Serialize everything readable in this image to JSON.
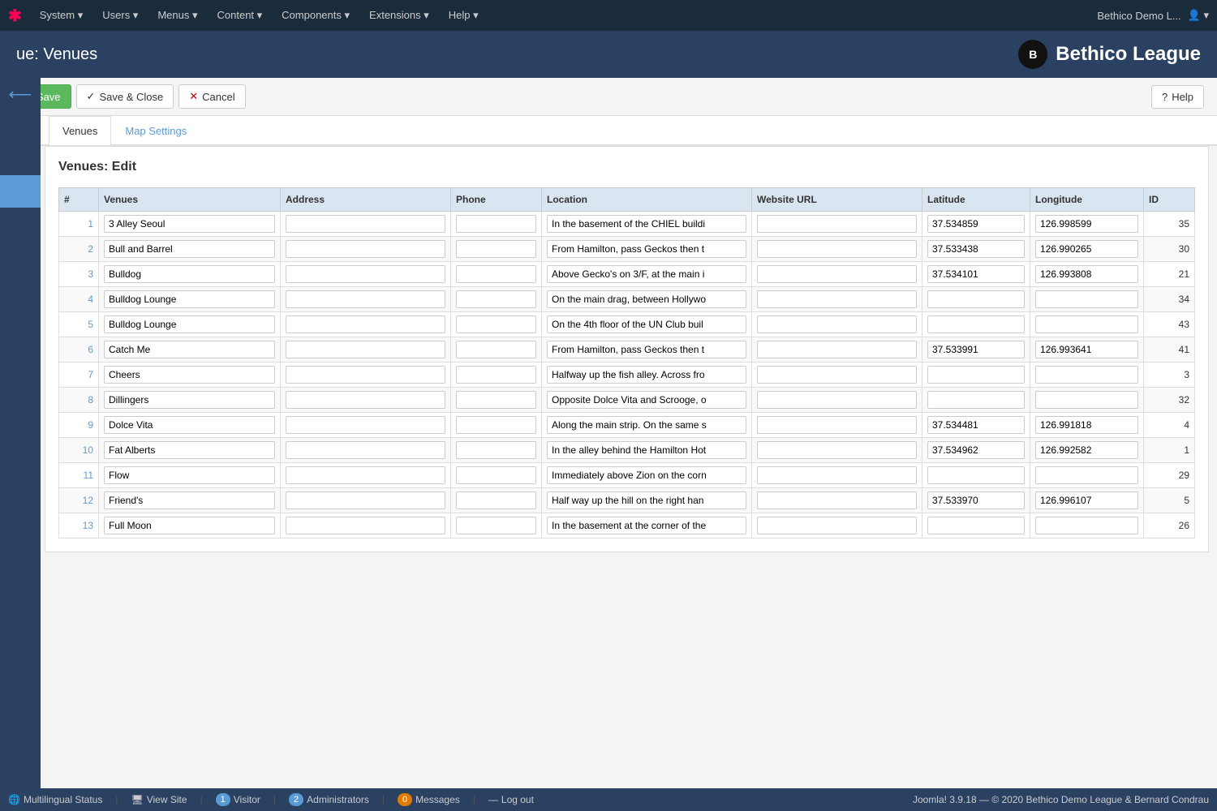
{
  "navbar": {
    "logo": "X",
    "items": [
      {
        "label": "System",
        "id": "system"
      },
      {
        "label": "Users",
        "id": "users"
      },
      {
        "label": "Menus",
        "id": "menus"
      },
      {
        "label": "Content",
        "id": "content"
      },
      {
        "label": "Components",
        "id": "components"
      },
      {
        "label": "Extensions",
        "id": "extensions"
      },
      {
        "label": "Help",
        "id": "help"
      }
    ],
    "user_text": "Bethico Demo L...",
    "user_icon": "👤"
  },
  "page_title": "ue: Venues",
  "brand": {
    "name": "Bethico League",
    "icon_text": "B"
  },
  "toolbar": {
    "save_label": "Save",
    "save_close_label": "Save & Close",
    "cancel_label": "Cancel",
    "help_label": "Help"
  },
  "tabs": [
    {
      "label": "Venues",
      "active": true
    },
    {
      "label": "Map Settings",
      "active": false
    }
  ],
  "section_title": "Venues: Edit",
  "table": {
    "columns": [
      "#",
      "Venues",
      "Address",
      "Phone",
      "Location",
      "Website URL",
      "Latitude",
      "Longitude",
      "ID"
    ],
    "rows": [
      {
        "num": 1,
        "venue": "3 Alley Seoul",
        "address": "",
        "phone": "",
        "location": "In the basement of the CHIEL buildi",
        "website": "",
        "latitude": "37.534859",
        "longitude": "126.998599",
        "id": 35
      },
      {
        "num": 2,
        "venue": "Bull and Barrel",
        "address": "",
        "phone": "",
        "location": "From Hamilton, pass Geckos then t",
        "website": "",
        "latitude": "37.533438",
        "longitude": "126.990265",
        "id": 30
      },
      {
        "num": 3,
        "venue": "Bulldog",
        "address": "",
        "phone": "",
        "location": "Above Gecko's on 3/F, at the main i",
        "website": "",
        "latitude": "37.534101",
        "longitude": "126.993808",
        "id": 21
      },
      {
        "num": 4,
        "venue": "Bulldog Lounge",
        "address": "",
        "phone": "",
        "location": "On the main drag, between Hollywo",
        "website": "",
        "latitude": "",
        "longitude": "",
        "id": 34
      },
      {
        "num": 5,
        "venue": "Bulldog Lounge",
        "address": "",
        "phone": "",
        "location": "On the 4th floor of the UN Club buil",
        "website": "",
        "latitude": "",
        "longitude": "",
        "id": 43
      },
      {
        "num": 6,
        "venue": "Catch Me",
        "address": "",
        "phone": "",
        "location": "From Hamilton, pass Geckos then t",
        "website": "",
        "latitude": "37.533991",
        "longitude": "126.993641",
        "id": 41
      },
      {
        "num": 7,
        "venue": "Cheers",
        "address": "",
        "phone": "",
        "location": "Halfway up the fish alley. Across fro",
        "website": "",
        "latitude": "",
        "longitude": "",
        "id": 3
      },
      {
        "num": 8,
        "venue": "Dillingers",
        "address": "",
        "phone": "",
        "location": "Opposite Dolce Vita and Scrooge, o",
        "website": "",
        "latitude": "",
        "longitude": "",
        "id": 32
      },
      {
        "num": 9,
        "venue": "Dolce Vita",
        "address": "",
        "phone": "",
        "location": "Along the main strip. On the same s",
        "website": "",
        "latitude": "37.534481",
        "longitude": "126.991818",
        "id": 4
      },
      {
        "num": 10,
        "venue": "Fat Alberts",
        "address": "",
        "phone": "",
        "location": "In the alley behind the Hamilton Hot",
        "website": "",
        "latitude": "37.534962",
        "longitude": "126.992582",
        "id": 1
      },
      {
        "num": 11,
        "venue": "Flow",
        "address": "",
        "phone": "",
        "location": "Immediately above Zion on the corn",
        "website": "",
        "latitude": "",
        "longitude": "",
        "id": 29
      },
      {
        "num": 12,
        "venue": "Friend's",
        "address": "",
        "phone": "",
        "location": "Half way up the hill on the right han",
        "website": "",
        "latitude": "37.533970",
        "longitude": "126.996107",
        "id": 5
      },
      {
        "num": 13,
        "venue": "Full Moon",
        "address": "",
        "phone": "",
        "location": "In the basement at the corner of the",
        "website": "",
        "latitude": "",
        "longitude": "",
        "id": 26
      }
    ]
  },
  "status_bar": {
    "multilingual": "Multilingual Status",
    "view_site": "View Site",
    "visitor_count": "1",
    "visitor_label": "Visitor",
    "admin_count": "2",
    "admin_label": "Administrators",
    "messages_count": "0",
    "messages_label": "Messages",
    "logout_label": "Log out",
    "joomla_info": "Joomla! 3.9.18 — © 2020 Bethico Demo League & Bernard Condrau"
  }
}
